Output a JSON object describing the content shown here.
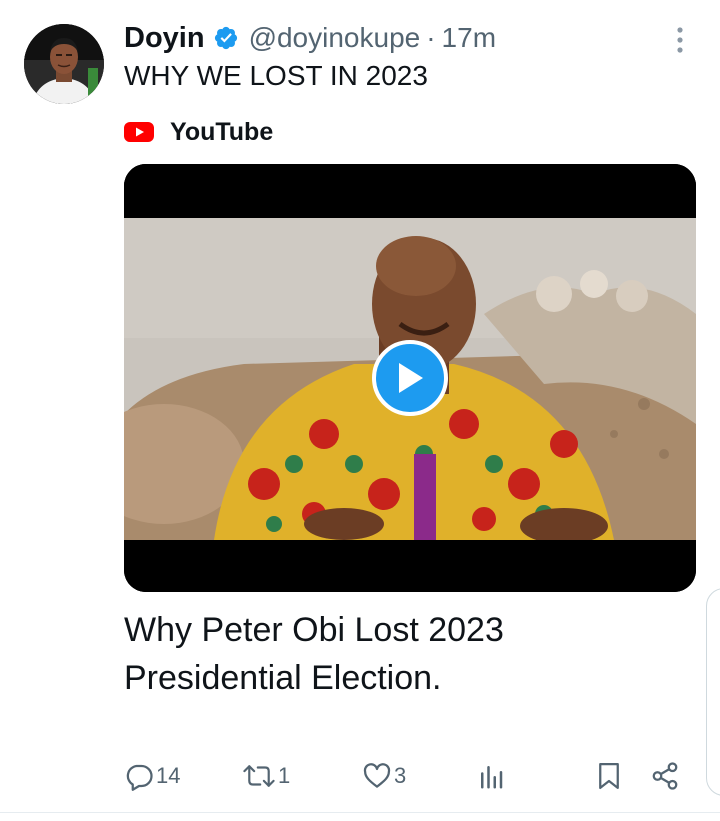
{
  "author": {
    "display_name": "Doyin",
    "handle": "@doyinokupe",
    "separator": "·",
    "time": "17m"
  },
  "tweet": {
    "text": "WHY WE LOST IN 2023"
  },
  "card": {
    "source": "YouTube",
    "title": "Why Peter Obi Lost 2023 Presidential Election."
  },
  "actions": {
    "replies": "14",
    "reposts": "1",
    "likes": "3"
  },
  "colors": {
    "accent": "#1d9bf0",
    "youtube_red": "#ff0000",
    "secondary_text": "#536471"
  }
}
